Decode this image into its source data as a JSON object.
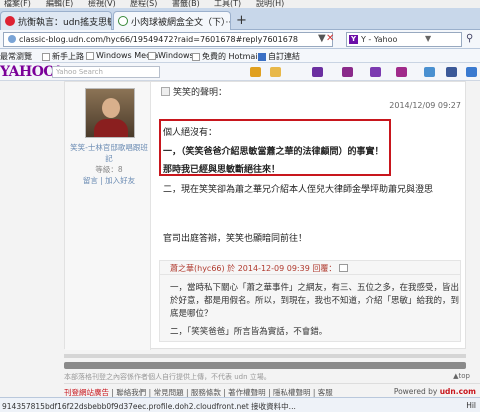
{
  "menu": [
    "檔案(F)",
    "編輯(E)",
    "檢視(V)",
    "歷程(S)",
    "書籤(B)",
    "工具(T)",
    "說明(H)"
  ],
  "tabs": [
    {
      "label": "抗衡執言：udn搖支思敏問..."
    },
    {
      "label": "小肉球被網盒全文（下）····"
    }
  ],
  "address": {
    "url": "classic-blog.udn.com/hyc66/19549472?raid=7601678#reply7601678"
  },
  "search": {
    "engine": "Y - Yahoo"
  },
  "bookmarks": [
    "最常瀏覽",
    "新手上路",
    "Windows Media",
    "Windows",
    "免費的 Hotmail",
    "自訂連結"
  ],
  "yahoo": {
    "logo": "YAHOO!",
    "search_placeholder": "Yahoo Search"
  },
  "profile": {
    "name_line1": "笑笑-士林官邸歌唱跟班",
    "name_line2": "記",
    "level": "等級：8",
    "links": "留言 | 加入好友"
  },
  "post": {
    "title": "笑笑的聲明：",
    "date": "2014/12/09 09:27",
    "line1": "個人絕沒有：",
    "line2": "一，（笑笑爸爸介紹思敏當蕭之華的法律顧問）的事實！",
    "line3": "那時我已經與思敏斷絕往來！",
    "line4": "二，現在笑笑卻為蕭之華兄介紹本人侄兒大律師金學坪助蕭兄與澄思",
    "line5": "官司出庭答辯，笑笑也顯暗同前往！"
  },
  "reply": {
    "header": "蕭之華(hyc66) 於 2014-12-09 09:39 回覆：",
    "line1": "一，當時私下關心「蕭之華事件」之網友，有三、五位之多，在我感受，皆出",
    "line2": "於好意，都是用假名。所以，到現在，我也不知道，介紹「思敏」給我的，到",
    "line3": "底是哪位？",
    "line4": "二，「笑笑爸爸」所言皆為實話，不會錯。"
  },
  "page": {
    "disclaimer": "本部落格刊登之內容係作者個人自行提供上傳，不代表 udn 立場。",
    "to_top": "▲top",
    "footer_links": "刊登網站廣告 | 聯絡我們 | 常見問題 | 服務條款 | 著作權聲明 | 隱私權聲明 | 客服",
    "footer_first": "刊登網站廣告",
    "footer_rest": " | 聯絡我們 | 常見問題 | 服務條款 | 著作權聲明 | 隱私權聲明 | 客服",
    "powered_prefix": "Powered by ",
    "powered_brand": "udn.com"
  },
  "status": {
    "text": "914357815bdf16f22dsbebb0f9d37eec.profile.doh2.cloudfront.net 接收資料中...",
    "zoom": "Hil"
  },
  "colors": {
    "highlight_border": "#c8161d",
    "yahoo_purple": "#7b0099"
  }
}
